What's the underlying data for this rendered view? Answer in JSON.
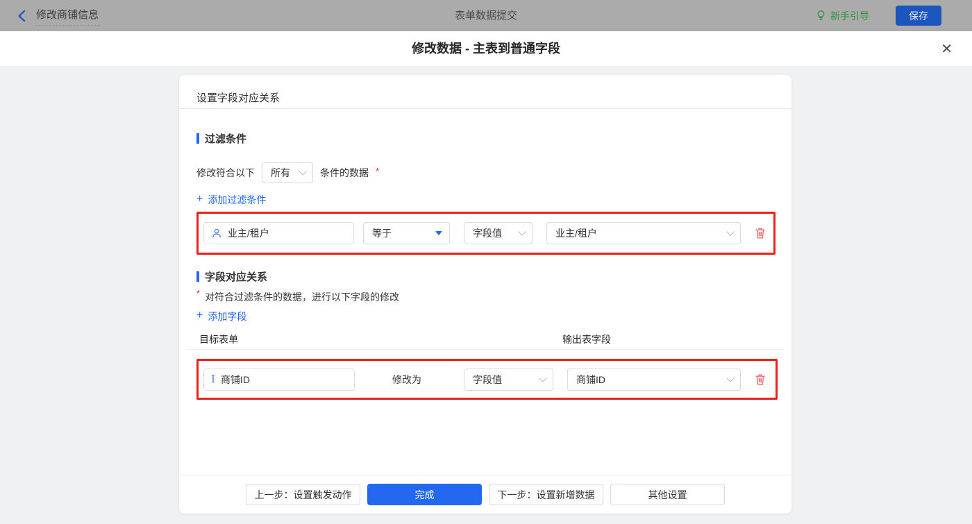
{
  "topbar": {
    "back_label": "修改商铺信息",
    "center_title": "表单数据提交",
    "guide_label": "新手引导",
    "save_label": "保存"
  },
  "modal": {
    "title": "修改数据 - 主表到普通字段"
  },
  "icons": {
    "close": "✕",
    "plus": "+"
  },
  "panel": {
    "header": "设置字段对应关系",
    "filter": {
      "title": "过滤条件",
      "prefix": "修改符合以下",
      "match_value": "所有",
      "suffix": "条件的数据",
      "required_mark": "*",
      "add_label": "添加过滤条件",
      "row": {
        "field": "业主/租户",
        "operator": "等于",
        "value_type": "字段值",
        "value": "业主/租户"
      }
    },
    "mapping": {
      "title": "字段对应关系",
      "required_mark": "*",
      "note": "对符合过滤条件的数据，进行以下字段的修改",
      "add_label": "添加字段",
      "col_target": "目标表单",
      "col_output": "输出表字段",
      "row": {
        "field": "商铺ID",
        "action": "修改为",
        "value_type": "字段值",
        "value": "商铺ID"
      }
    },
    "footer": {
      "prev": "上一步：设置触发动作",
      "done": "完成",
      "next": "下一步：设置新增数据",
      "other": "其他设置"
    }
  },
  "colors": {
    "accent_blue": "#2468f2",
    "highlight_red": "#ee2117",
    "danger_soft": "#f56c6c",
    "guide_green": "#2f9242",
    "topbar_dimmed": "#ababab"
  }
}
